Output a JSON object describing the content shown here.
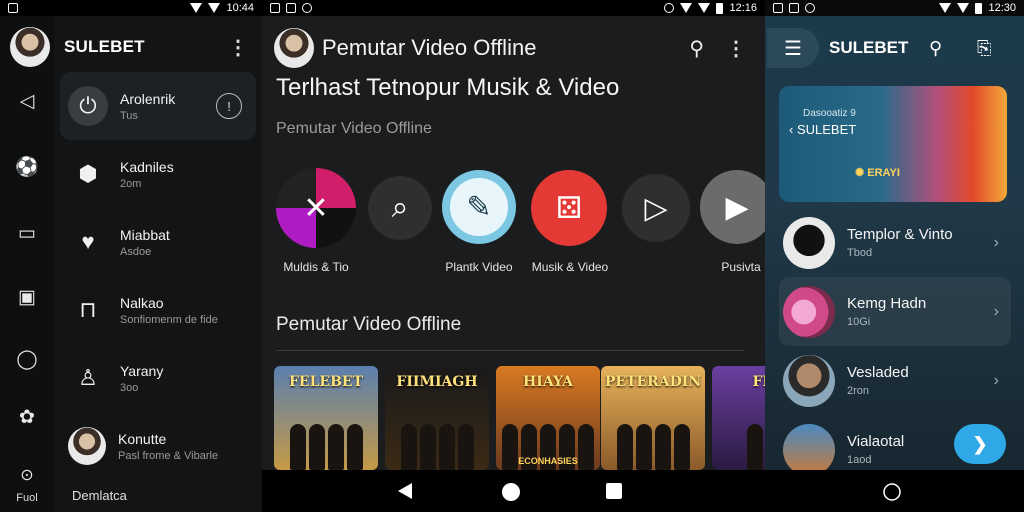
{
  "panel1": {
    "status_time": "10:44",
    "title": "SULEBET",
    "items": [
      {
        "title": "Arolenrik",
        "subtitle": "Tus",
        "lead_icon": "power-icon",
        "trail_icon": "info-icon"
      },
      {
        "title": "Kadniles",
        "subtitle": "2om",
        "lead_icon": "box-icon"
      },
      {
        "title": "Miabbat",
        "subtitle": "Asdoe",
        "lead_icon": "heart-icon"
      },
      {
        "title": "Nalkao",
        "subtitle": "Sonfiomenm de fide",
        "lead_icon": "book-icon"
      },
      {
        "title": "Yarany",
        "subtitle": "3oo",
        "lead_icon": "microphone-icon"
      },
      {
        "title": "Konutte",
        "subtitle": "Pasl frome & Vibarle",
        "lead_icon": "avatar"
      }
    ],
    "rail_icons": [
      "speaker-icon",
      "ball-icon",
      "tv-icon",
      "radio-icon",
      "chat-icon",
      "flower-icon",
      "compass-icon"
    ],
    "rail_bottom_label": "Fuol",
    "footer": "Demlatca"
  },
  "panel2": {
    "status_time": "12:16",
    "title": "Pemutar Video Offline",
    "heading": "Terlhast Tetnopur Musik & Video",
    "subheading": "Pemutar Video Offline",
    "circles": [
      {
        "label": "Muldis & Tio",
        "color": "#1f1f1f"
      },
      {
        "label": "",
        "color": "#2e2f31"
      },
      {
        "label": "Plantk Video",
        "color": "#bfe4f2"
      },
      {
        "label": "Musik & Video",
        "color": "#e53935"
      },
      {
        "label": "",
        "color": "#2e2f31"
      },
      {
        "label": "Pusivta",
        "color": "#6b6b6b"
      }
    ],
    "section_title": "Pemutar Video Offline",
    "posters": [
      {
        "title": "FELEBET",
        "top": "#5a7fb0",
        "bottom": "#c69a45"
      },
      {
        "title": "FIIMIAGH",
        "top": "#1a1a1a",
        "bottom": "#3b2a16"
      },
      {
        "title": "HIAYA",
        "top": "#d97a22",
        "bottom": "#6a3a1e"
      },
      {
        "title": "PETERADIN",
        "top": "#e7b25a",
        "bottom": "#8a5a2a"
      },
      {
        "title": "FII",
        "top": "#6a3fa0",
        "bottom": "#2a1a40"
      }
    ],
    "poster_caption": "ECONHASIES"
  },
  "panel3": {
    "status_time": "12:30",
    "title": "SULEBET",
    "banner_line1": "Dasooatiz 9",
    "banner_line2": "SULEBET",
    "banner_line3": "ERAYI",
    "items": [
      {
        "title": "Templor & Vinto",
        "subtitle": "Tbod",
        "thumb": "#e9e9e9"
      },
      {
        "title": "Kemg Hadn",
        "subtitle": "10Gi",
        "thumb": "#d04a8a"
      },
      {
        "title": "Vesladed",
        "subtitle": "2ron",
        "thumb": "#8aa6b8"
      },
      {
        "title": "Vialaotal",
        "subtitle": "1aod",
        "thumb": "#c77a3a"
      }
    ]
  }
}
